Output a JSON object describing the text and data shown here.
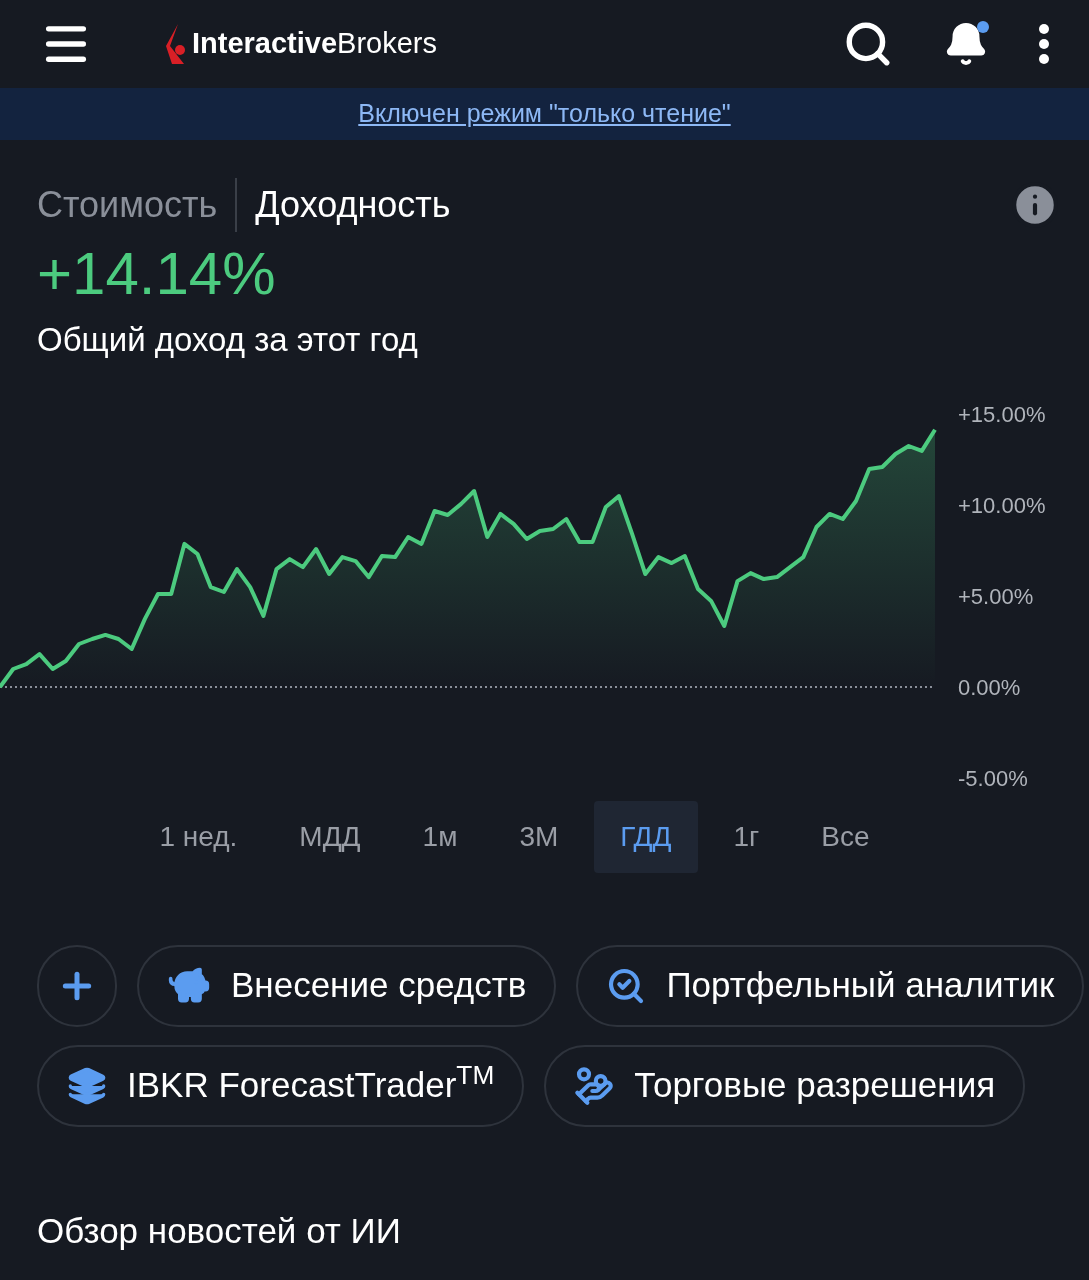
{
  "header": {
    "logo_bold": "Interactive",
    "logo_regular": "Brokers",
    "notification_dot": true
  },
  "banner": {
    "text": "Включен режим \"только чтение\""
  },
  "view_tabs": [
    {
      "label": "Стоимость",
      "selected": false
    },
    {
      "label": "Доходность",
      "selected": true
    }
  ],
  "summary": {
    "value": "+14.14%",
    "caption": "Общий доход за этот год"
  },
  "chart_data": {
    "type": "area",
    "ylim": [
      -5,
      15
    ],
    "yticks": [
      {
        "value": 15,
        "label": "+15.00%"
      },
      {
        "value": 10,
        "label": "+10.00%"
      },
      {
        "value": 5,
        "label": "+5.00%"
      },
      {
        "value": 0,
        "label": "0.00%"
      },
      {
        "value": -5,
        "label": "-5.00%"
      }
    ],
    "series": [
      {
        "color": "#4ccb7f",
        "values": [
          0,
          0.99,
          1.26,
          1.81,
          0.99,
          1.43,
          2.36,
          2.64,
          2.86,
          2.64,
          2.09,
          3.74,
          5.11,
          5.11,
          7.86,
          7.31,
          5.49,
          5.22,
          6.48,
          5.49,
          3.9,
          6.48,
          7.03,
          6.59,
          7.58,
          6.21,
          7.14,
          6.92,
          6.04,
          7.2,
          7.14,
          8.24,
          7.86,
          9.67,
          9.45,
          10.05,
          10.77,
          8.24,
          9.51,
          8.96,
          8.13,
          8.57,
          8.68,
          9.23,
          7.97,
          7.97,
          9.89,
          10.49,
          8.41,
          6.21,
          7.14,
          6.81,
          7.2,
          5.38,
          4.73,
          3.35,
          5.82,
          6.26,
          5.93,
          6.04,
          6.59,
          7.14,
          8.79,
          9.51,
          9.23,
          10.22,
          11.98,
          12.09,
          12.8,
          13.24,
          12.97,
          14.14
        ]
      }
    ]
  },
  "periods": [
    {
      "label": "1 нед.",
      "selected": false
    },
    {
      "label": "МДД",
      "selected": false
    },
    {
      "label": "1м",
      "selected": false
    },
    {
      "label": "3М",
      "selected": false
    },
    {
      "label": "ГДД",
      "selected": true
    },
    {
      "label": "1г",
      "selected": false
    },
    {
      "label": "Все",
      "selected": false
    }
  ],
  "actions": [
    {
      "kind": "add"
    },
    {
      "kind": "deposit",
      "label": "Внесение средств"
    },
    {
      "kind": "analyst",
      "label": "Портфельный аналитик"
    },
    {
      "kind": "forecast",
      "label": "IBKR ForecastTrader$^{TM}$"
    },
    {
      "kind": "permissions",
      "label": "Торговые разрешения"
    }
  ],
  "news": {
    "title": "Обзор новостей от ИИ"
  }
}
